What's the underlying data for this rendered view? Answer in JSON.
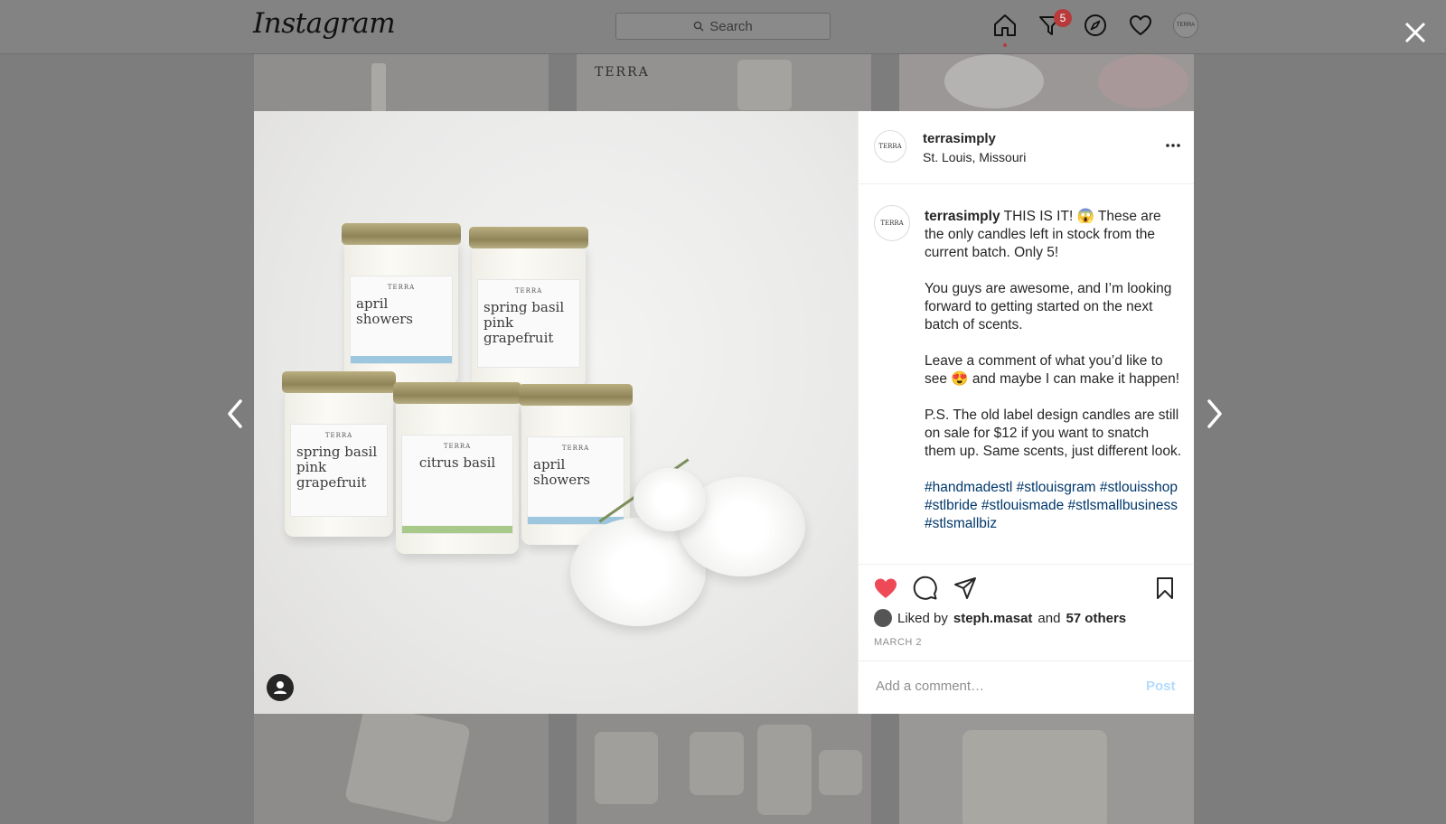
{
  "app": {
    "logo_text": "Instagram"
  },
  "search": {
    "placeholder": "Search"
  },
  "nav": {
    "activity_badge": "5",
    "profile_avatar_text": "TERRA"
  },
  "background_tiles": {
    "top_middle_text": "TERRA"
  },
  "post": {
    "avatar_text": "TERRA",
    "username": "terrasimply",
    "location": "St. Louis, Missouri",
    "caption_username": "terrasimply",
    "caption_p1": " THIS IS IT! 😱 These are the only candles left in stock from the current batch. Only 5!",
    "caption_p2": "You guys are awesome, and I’m looking forward to getting started on the next batch of scents.",
    "caption_p3": "Leave a comment of what you’d like to see 😍 and maybe I can make it happen!",
    "caption_p4": "P.S. The old label design candles are still on sale for $12 if you want to snatch them up. Same scents, just different look.",
    "hashtags": "#handmadestl #stlouisgram #stlouisshop #stlbride #stlouismade #stlsmallbusiness #stlsmallbiz",
    "liked_by_prefix": "Liked by",
    "liked_by_user": "steph.masat",
    "liked_by_and": "and",
    "liked_by_others": "57 others",
    "date": "MARCH 2",
    "comment_placeholder": "Add a comment…",
    "post_button": "Post",
    "like_color": "#ed4956"
  },
  "candles": {
    "brand": "TERRA",
    "c1": "april showers",
    "c2": "spring basil pink grapefruit",
    "c3": "spring basil pink grapefruit",
    "c4": "citrus basil",
    "c5": "april showers"
  }
}
